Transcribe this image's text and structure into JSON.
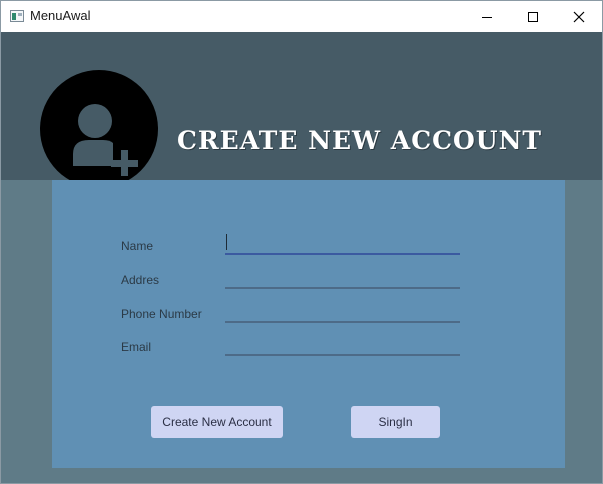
{
  "window": {
    "title": "MenuAwal",
    "controls": {
      "minimize": "minimize",
      "maximize": "maximize",
      "close": "close"
    }
  },
  "header": {
    "icon": "add-user-icon",
    "title": "CREATE NEW ACCOUNT"
  },
  "form": {
    "fields": [
      {
        "label": "Name",
        "value": "",
        "focused": true
      },
      {
        "label": "Addres",
        "value": ""
      },
      {
        "label": "Phone Number",
        "value": ""
      },
      {
        "label": "Email",
        "value": ""
      }
    ],
    "buttons": {
      "create": "Create New Account",
      "signin": "SingIn"
    }
  },
  "colors": {
    "background": "#5f7b87",
    "header": "#465b66",
    "panel": "#6090b4",
    "button": "#cfd5f3",
    "accent_underline": "#3b5aa0"
  }
}
